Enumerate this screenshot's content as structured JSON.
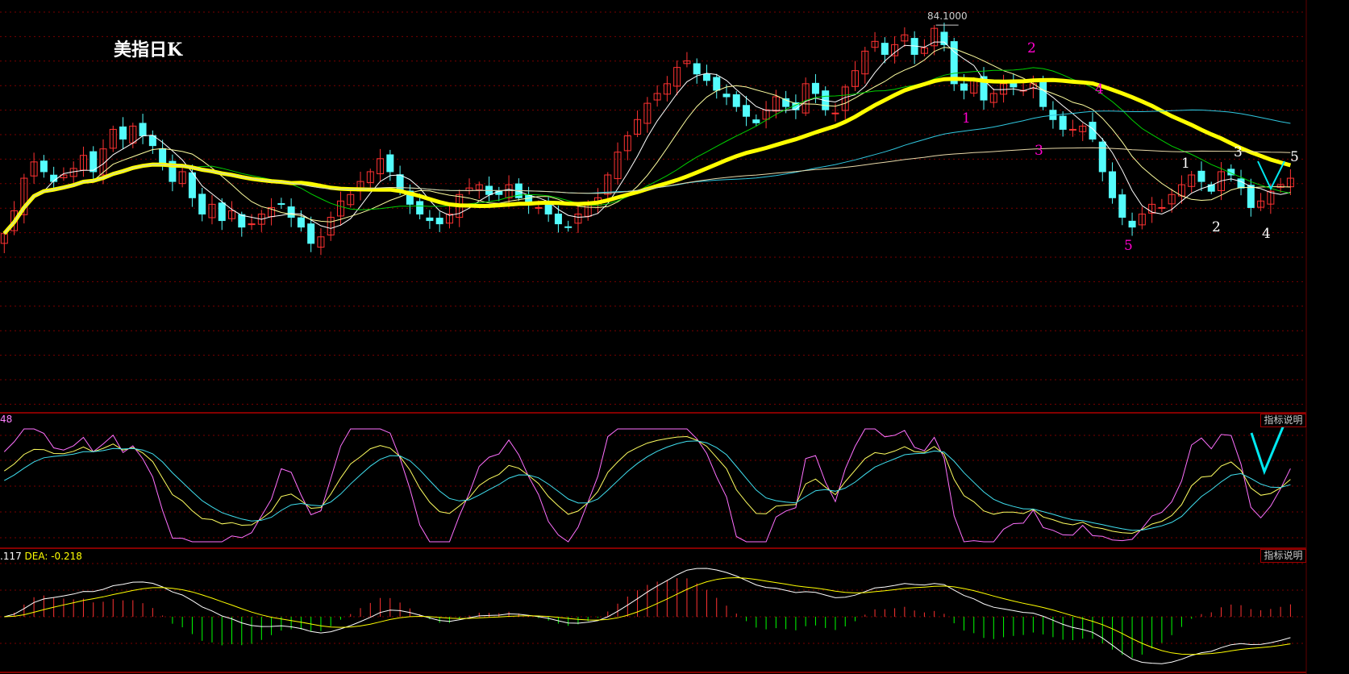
{
  "title": "美指日K",
  "max_marker": "84.1000",
  "kdj_header": {
    "value_text": "48"
  },
  "macd_header": {
    "dif_text": ".117",
    "dea_text": "DEA: -0.218"
  },
  "help_label": "指标说明",
  "annotations_pink": [
    "1",
    "2",
    "3",
    "4",
    "5"
  ],
  "annotations_white": [
    "1",
    "2",
    "3",
    "4",
    "5"
  ],
  "colors": {
    "up": "#ff3232",
    "down": "#54fcfc",
    "grid": "#7a0000",
    "ma_thick": "#ffff00",
    "pink": "#ff00cc"
  },
  "chart_data": {
    "type": "candlestick",
    "title": "美指日K",
    "ylim": [
      72.2,
      84.87
    ],
    "highest": 84.1,
    "closes": [
      77.7,
      78.4,
      79.4,
      79.9,
      79.6,
      79.3,
      79.5,
      79.7,
      80.1,
      79.6,
      80.3,
      80.9,
      80.6,
      81.0,
      80.7,
      80.4,
      79.8,
      79.3,
      79.6,
      78.8,
      78.3,
      78.6,
      78.1,
      78.4,
      77.9,
      78.0,
      78.3,
      78.5,
      78.6,
      78.2,
      77.9,
      77.4,
      77.6,
      78.2,
      78.7,
      78.9,
      79.3,
      79.6,
      80.0,
      79.6,
      79.0,
      78.6,
      78.3,
      78.1,
      78.0,
      78.3,
      78.9,
      79.1,
      79.2,
      78.9,
      78.9,
      79.2,
      78.8,
      78.6,
      78.5,
      78.3,
      78.0,
      77.9,
      78.3,
      78.6,
      78.8,
      79.5,
      80.2,
      80.7,
      81.2,
      81.7,
      82.0,
      82.3,
      82.8,
      83.0,
      82.6,
      82.4,
      82.1,
      81.9,
      81.6,
      81.3,
      81.1,
      81.5,
      81.9,
      81.6,
      81.5,
      82.3,
      82.0,
      81.5,
      81.4,
      82.2,
      82.7,
      83.3,
      83.6,
      83.2,
      83.5,
      83.8,
      83.2,
      83.4,
      84.0,
      83.5,
      82.3,
      82.1,
      82.4,
      81.8,
      82.0,
      82.3,
      82.2,
      82.1,
      82.3,
      81.6,
      81.2,
      80.9,
      80.9,
      81.0,
      80.6,
      79.6,
      78.8,
      78.2,
      77.9,
      78.3,
      78.6,
      78.5,
      78.9,
      79.2,
      79.5,
      79.3,
      79.0,
      79.6,
      79.5,
      79.1,
      78.5,
      78.7,
      79.0,
      79.2,
      79.4
    ],
    "moving_averages": [
      {
        "period": 5,
        "color": "#ffffff"
      },
      {
        "period": 10,
        "color": "#ffffa0"
      },
      {
        "period": 20,
        "color": "#00d000"
      },
      {
        "period": 30,
        "color": "#ffff00",
        "thick": true
      },
      {
        "period": 60,
        "color": "#30c8e0"
      },
      {
        "period": 120,
        "color": "#e8d8a8"
      }
    ],
    "indicators": [
      "KDJ",
      "MACD"
    ]
  }
}
